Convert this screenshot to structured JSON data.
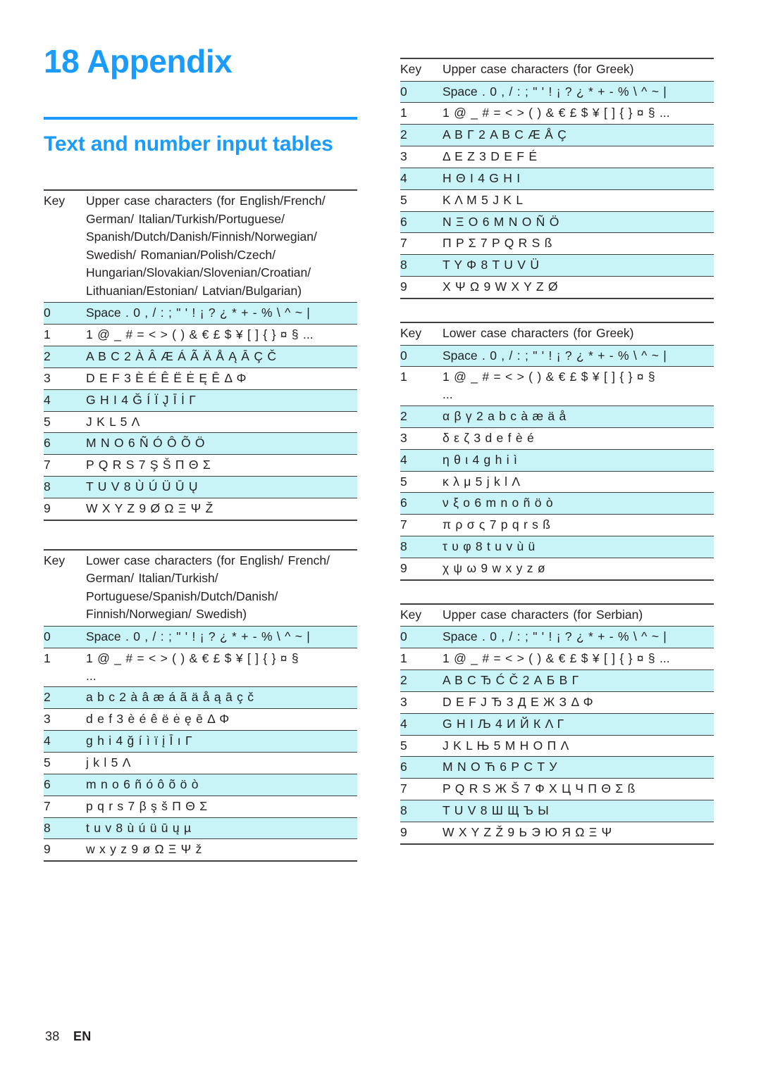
{
  "chapter": {
    "number": "18",
    "title": "Appendix"
  },
  "section": {
    "title": "Text and number input tables"
  },
  "footer": {
    "page_number": "38",
    "language_code": "EN"
  },
  "colors": {
    "accent_blue": "#1b9cfc",
    "row_highlight": "#c8f4f7",
    "rule": "#3f3f3f",
    "text": "#231f20"
  },
  "tables": [
    {
      "id": "upper-latin",
      "column": "left",
      "key_header": "Key",
      "value_header": "Upper case characters (for English/French/ German/ Italian/Turkish/Portuguese/ Spanish/Dutch/Danish/Finnish/Norwegian/ Swedish/ Romanian/Polish/Czech/ Hungarian/Slovakian/Slovenian/Croatian/ Lithuanian/Estonian/ Latvian/Bulgarian)",
      "rows": [
        {
          "key": "0",
          "value": "Space . 0 , / : ; \" ' ! ¡ ? ¿ * + - % \\ ^ ~ |"
        },
        {
          "key": "1",
          "value": "1 @ _ # = < > ( ) & € £ $ ¥ [ ] { } ¤ § ..."
        },
        {
          "key": "2",
          "value": "A B C 2 À Â Æ Á Ã Ä Å Ą Ā Ç Č"
        },
        {
          "key": "3",
          "value": "D E F 3 È É Ê Ë Ė Ę Ē Δ Φ"
        },
        {
          "key": "4",
          "value": "G H I 4 Ğ Í Ï J̨ Ī İ Γ"
        },
        {
          "key": "5",
          "value": "J K L 5 Λ"
        },
        {
          "key": "6",
          "value": "M N O 6 Ñ Ó Ô Õ Ö"
        },
        {
          "key": "7",
          "value": "P Q R S 7 Ş Š Π Θ Σ"
        },
        {
          "key": "8",
          "value": "T U V 8 Ù Ú Ü Ū Ų"
        },
        {
          "key": "9",
          "value": "W X Y Z 9 Ø Ω Ξ Ψ Ž"
        }
      ]
    },
    {
      "id": "lower-latin",
      "column": "left",
      "key_header": "Key",
      "value_header": "Lower case characters (for English/ French/ German/ Italian/Turkish/ Portuguese/Spanish/Dutch/Danish/ Finnish/Norwegian/ Swedish)",
      "rows": [
        {
          "key": "0",
          "value": "Space . 0 , / : ; \" ' ! ¡ ? ¿ * + - % \\ ^ ~ |"
        },
        {
          "key": "1",
          "value": "1 @ _ # = < > ( ) & € £ $ ¥ [ ] { } ¤ §",
          "value2": "..."
        },
        {
          "key": "2",
          "value": "a b c 2 à â æ á ã ä å ą ā ç č"
        },
        {
          "key": "3",
          "value": "d e f 3 è é ê ë ė ę ē Δ Φ"
        },
        {
          "key": "4",
          "value": "g h i 4 ğ í ì ï į Ī ı Γ"
        },
        {
          "key": "5",
          "value": "j k l 5 Λ"
        },
        {
          "key": "6",
          "value": "m n o 6 ñ ó ô õ ö ò"
        },
        {
          "key": "7",
          "value": "p q r s 7 β ş š Π Θ Σ"
        },
        {
          "key": "8",
          "value": "t u v 8 ù ú ü ū ų µ"
        },
        {
          "key": "9",
          "value": "w x y z 9 ø Ω Ξ Ψ ž"
        }
      ]
    },
    {
      "id": "upper-greek",
      "column": "right",
      "key_header": "Key",
      "value_header": "Upper case characters (for Greek)",
      "rows": [
        {
          "key": "0",
          "value": "Space . 0 , / : ; \" ' ! ¡ ? ¿ * + - % \\ ^ ~ |"
        },
        {
          "key": "1",
          "value": "1 @ _ # = < > ( ) & € £ $ ¥ [ ] { } ¤ § ..."
        },
        {
          "key": "2",
          "value": "Α Β Γ 2 A B C Æ Å Ç"
        },
        {
          "key": "3",
          "value": "Δ Ε Ζ 3 D E F É"
        },
        {
          "key": "4",
          "value": "Η Θ Ι 4 G H I"
        },
        {
          "key": "5",
          "value": "Κ Λ Μ 5 J K L"
        },
        {
          "key": "6",
          "value": "Ν Ξ Ο 6 M N O Ñ Ö"
        },
        {
          "key": "7",
          "value": "Π Ρ Σ 7 P Q R S ß"
        },
        {
          "key": "8",
          "value": "Τ Υ Φ 8 T U V Ü"
        },
        {
          "key": "9",
          "value": "Χ Ψ Ω 9 W X Y Z Ø"
        }
      ]
    },
    {
      "id": "lower-greek",
      "column": "right",
      "key_header": "Key",
      "value_header": "Lower case characters (for Greek)",
      "rows": [
        {
          "key": "0",
          "value": "Space . 0 , / : ; \" ' ! ¡ ? ¿ * + - % \\ ^ ~ |"
        },
        {
          "key": "1",
          "value": "1 @ _ # = < > ( ) & € £ $ ¥ [ ] { } ¤ §",
          "value2": "..."
        },
        {
          "key": "2",
          "value": "α β γ 2 a b c à æ ä å"
        },
        {
          "key": "3",
          "value": "δ ε ζ 3 d e f è é"
        },
        {
          "key": "4",
          "value": "η θ ι 4 g h i ì"
        },
        {
          "key": "5",
          "value": "κ λ μ 5 j k l Λ"
        },
        {
          "key": "6",
          "value": "ν ξ ο 6 m n o ñ ö ò"
        },
        {
          "key": "7",
          "value": "π ρ σ ς 7 p q r s ß"
        },
        {
          "key": "8",
          "value": "τ υ φ 8 t u v ù ü"
        },
        {
          "key": "9",
          "value": "χ ψ ω 9 w x y z ø"
        }
      ]
    },
    {
      "id": "upper-serbian",
      "column": "right",
      "key_header": "Key",
      "value_header": "Upper case characters (for Serbian)",
      "rows": [
        {
          "key": "0",
          "value": "Space . 0 , / : ; \" ' ! ¡ ? ¿ * + - % \\ ^ ~ |"
        },
        {
          "key": "1",
          "value": "1 @ _ # = < > ( ) & € £ $ ¥ [ ] { } ¤ § ..."
        },
        {
          "key": "2",
          "value": "A B C Ђ Ć Č 2 А Б В Г"
        },
        {
          "key": "3",
          "value": "D E F J Ђ 3 Д Е Ж З Δ Φ"
        },
        {
          "key": "4",
          "value": "G H I Љ 4 И Й К Λ Γ"
        },
        {
          "key": "5",
          "value": "J K L Њ 5 М Н О П Λ"
        },
        {
          "key": "6",
          "value": "M N O Ћ 6 Р С Т У"
        },
        {
          "key": "7",
          "value": "P Q R S Ж Š 7 Ф Х Ц Ч Π Θ Σ ß"
        },
        {
          "key": "8",
          "value": "T U V 8 Ш Щ Ъ Ы"
        },
        {
          "key": "9",
          "value": "W X Y Z Ž 9 Ь Э Ю Я Ω Ξ Ψ"
        }
      ]
    }
  ]
}
